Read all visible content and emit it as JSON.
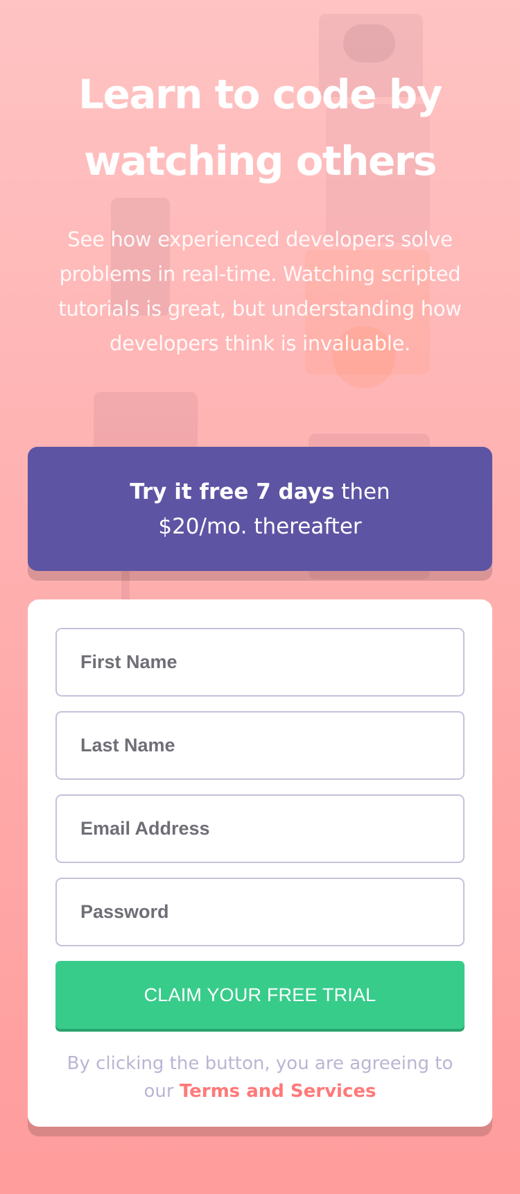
{
  "hero": {
    "title": "Learn to code by watching others",
    "description": "See how experienced developers solve problems in real-time. Watching scripted tutorials is great, but understanding how developers think is invaluable."
  },
  "offer": {
    "strong_text": "Try it free 7 days",
    "rest_text": " then $20/mo. thereafter"
  },
  "form": {
    "first_name_placeholder": "First Name",
    "last_name_placeholder": "Last Name",
    "email_placeholder": "Email Address",
    "password_placeholder": "Password",
    "submit_label": "CLAIM YOUR FREE TRIAL",
    "terms_prefix": "By clicking the button, you are agreeing to our ",
    "terms_link": "Terms and Services"
  },
  "colors": {
    "background": "#ff7979",
    "banner": "#5e54a4",
    "button": "#38cc8b",
    "link": "#ff7979"
  }
}
